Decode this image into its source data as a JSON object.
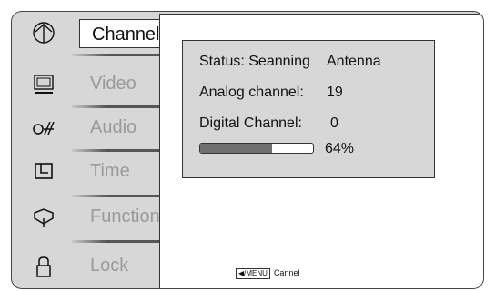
{
  "menu": {
    "items": [
      {
        "label": "Channel",
        "icon": "antenna-icon",
        "active": true
      },
      {
        "label": "Video",
        "icon": "monitor-icon",
        "active": false
      },
      {
        "label": "Audio",
        "icon": "audio-icon",
        "active": false
      },
      {
        "label": "Time",
        "icon": "clock-icon",
        "active": false
      },
      {
        "label": "Function",
        "icon": "function-icon",
        "active": false
      },
      {
        "label": "Lock",
        "icon": "lock-icon",
        "active": false
      }
    ]
  },
  "status": {
    "status_label": "Status: Seanning",
    "status_value": "Antenna",
    "analog_label": "Analog channel:",
    "analog_value": "19",
    "digital_label": "Digital Channel:",
    "digital_value": "0",
    "progress_fraction": 0.64,
    "progress_text": "64%"
  },
  "footer": {
    "menu_key": "◀/MENU",
    "hint": "Cannel"
  },
  "colors": {
    "frame_bg": "#d7d7d7",
    "panel_bg": "#ffffff",
    "progress_fill": "#6f6f6f"
  }
}
